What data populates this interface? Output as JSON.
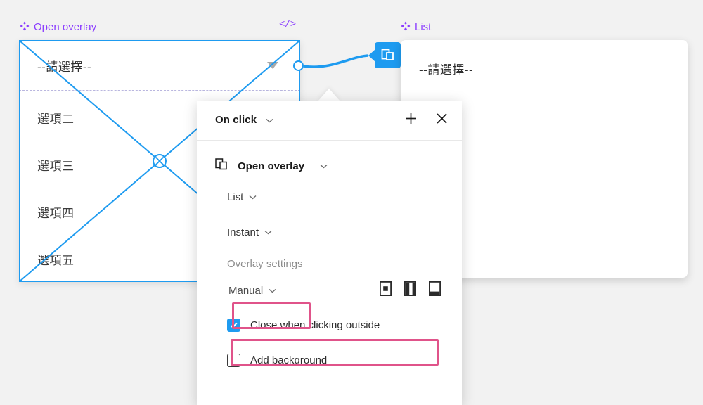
{
  "canvas": {
    "background_color": "#f2f2f2",
    "accent_blue": "#1e9bf0",
    "component_purple": "#8b3dff",
    "highlight_pink": "#e0538a"
  },
  "left_frame": {
    "label": "Open overlay",
    "component_icon": "component-diamond-icon",
    "code_icon": "code-brackets-icon",
    "code_icon_text": "</>",
    "select_value": "--請選擇--",
    "caret_icon": "triangle-down-icon",
    "options": [
      "選項二",
      "選項三",
      "選項四",
      "選項五"
    ],
    "selection_badge_icon": "circle-x-icon"
  },
  "connector": {
    "endpoint_icon": "connector-endpoint-circle",
    "badge_icon": "open-overlay-icon"
  },
  "right_frame": {
    "label": "List",
    "component_icon": "component-diamond-icon",
    "select_value": "--請選擇--"
  },
  "popup": {
    "title": "On click",
    "title_chevron_icon": "chevron-down-icon",
    "add_icon": "plus-icon",
    "close_icon": "close-icon",
    "action": {
      "icon": "open-overlay-icon",
      "label": "Open overlay",
      "chevron_icon": "chevron-down-icon"
    },
    "destination": {
      "label": "List",
      "chevron_icon": "chevron-down-icon"
    },
    "animation": {
      "label": "Instant",
      "chevron_icon": "chevron-down-icon"
    },
    "overlay_settings_label": "Overlay settings",
    "position": {
      "label": "Manual",
      "chevron_icon": "chevron-down-icon",
      "presets": [
        {
          "name": "position-center-icon"
        },
        {
          "name": "position-left-icon"
        },
        {
          "name": "position-bottom-icon"
        }
      ]
    },
    "checkboxes": [
      {
        "label": "Close when clicking outside",
        "checked": true
      },
      {
        "label": "Add background",
        "checked": false
      }
    ]
  }
}
